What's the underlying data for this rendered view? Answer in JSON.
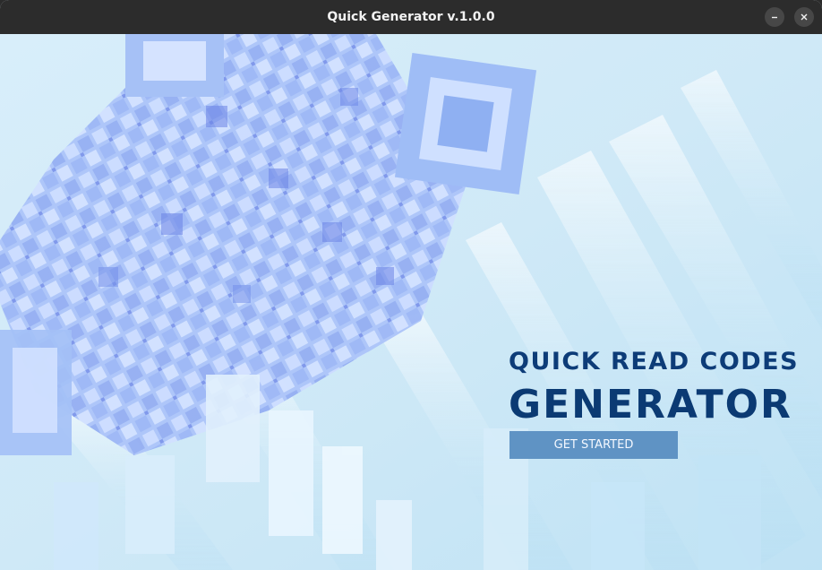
{
  "window": {
    "title": "Quick Generator v.1.0.0",
    "minimize_label": "–",
    "close_label": "×"
  },
  "hero": {
    "line1": "QUICK READ CODES",
    "line2": "GENERATOR",
    "button_label": "GET STARTED"
  },
  "colors": {
    "titlebar": "#2c2c2c",
    "headline": "#0d3c78",
    "button": "#5f93c4",
    "background": "#e6f4fb"
  },
  "icons": {
    "minimize": "minimize-icon",
    "close": "close-icon",
    "background": "qr-code-3d-artwork"
  }
}
